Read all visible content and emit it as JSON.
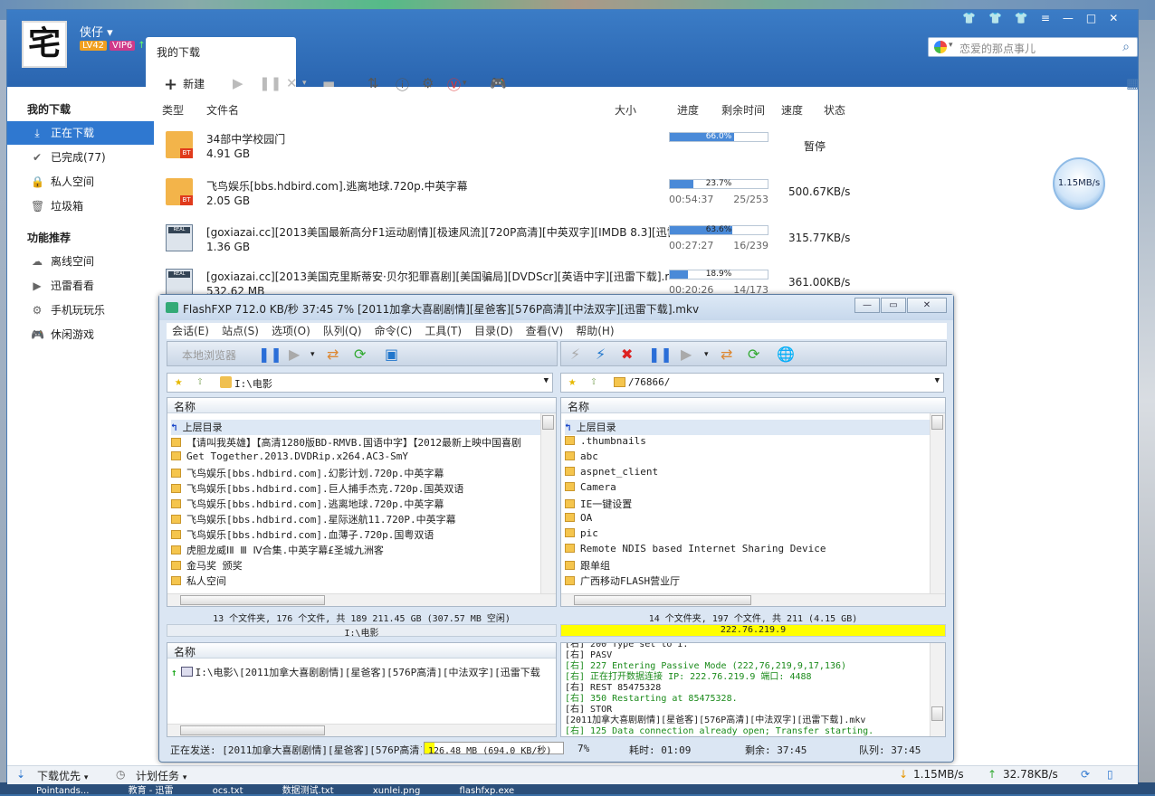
{
  "desktop": {
    "taskbar_items": [
      "Pointands...",
      "教育 - 迅雷",
      "ocs.txt",
      "数据测试.txt",
      "xunlei.png",
      "flashfxp.exe"
    ]
  },
  "xunlei": {
    "avatar_text": "宅",
    "username": "侠仔",
    "level": "LV42",
    "vip": "VIP6",
    "tab_title": "我的下载",
    "search_placeholder": "恋爱的那点事儿",
    "toolbar": {
      "new_label": "新建"
    },
    "sidebar": {
      "section1": "我的下载",
      "items1": [
        {
          "label": "正在下载",
          "icon": "download-icon"
        },
        {
          "label": "已完成(77)",
          "icon": "check-icon"
        },
        {
          "label": "私人空间",
          "icon": "lock-icon"
        },
        {
          "label": "垃圾箱",
          "icon": "trash-icon"
        }
      ],
      "section2": "功能推荐",
      "items2": [
        {
          "label": "离线空间",
          "icon": "cloud-icon"
        },
        {
          "label": "迅雷看看",
          "icon": "play-icon"
        },
        {
          "label": "手机玩玩乐",
          "icon": "gear-icon"
        },
        {
          "label": "休闲游戏",
          "icon": "gamepad-icon"
        }
      ]
    },
    "columns": {
      "type": "类型",
      "name": "文件名",
      "size": "大小",
      "progress": "进度",
      "remaining": "剩余时间",
      "speed": "速度",
      "status": "状态"
    },
    "rows": [
      {
        "name": "34部中学校园门",
        "size": "4.91 GB",
        "progress_label": "66.0%",
        "progress": 0.66,
        "eta": "",
        "blocks": "",
        "speed": "",
        "status": "暂停",
        "icon": "bt"
      },
      {
        "name": "飞鸟娱乐[bbs.hdbird.com].逃离地球.720p.中英字幕",
        "size": "2.05 GB",
        "progress_label": "23.7%",
        "progress": 0.237,
        "eta": "00:54:37",
        "blocks": "25/253",
        "speed": "500.67KB/s",
        "status": "",
        "icon": "bt"
      },
      {
        "name": "[goxiazai.cc][2013美国最新高分F1运动剧情][极速风流][720P高清][中英双字][IMDB 8.3][迅雷...",
        "size": "1.36 GB",
        "progress_label": "63.6%",
        "progress": 0.636,
        "eta": "00:27:27",
        "blocks": "16/239",
        "speed": "315.77KB/s",
        "status": "",
        "icon": "real"
      },
      {
        "name": "[goxiazai.cc][2013美国克里斯蒂安·贝尔犯罪喜剧][美国骗局][DVDScr][英语中字][迅雷下载].rmvb",
        "size": "532.62 MB",
        "progress_label": "18.9%",
        "progress": 0.189,
        "eta": "00:20:26",
        "blocks": "14/173",
        "speed": "361.00KB/s",
        "status": "",
        "icon": "real"
      }
    ],
    "speed_ball": "1.15MB/s",
    "status": {
      "priority": "下载优先",
      "schedule": "计划任务",
      "down": "1.15MB/s",
      "up": "32.78KB/s"
    }
  },
  "fxp": {
    "title": "FlashFXP 712.0 KB/秒 37:45 7% [2011加拿大喜剧剧情][星爸客][576P高清][中法双字][迅雷下载].mkv",
    "menu": [
      "会话(E)",
      "站点(S)",
      "选项(O)",
      "队列(Q)",
      "命令(C)",
      "工具(T)",
      "目录(D)",
      "查看(V)",
      "帮助(H)"
    ],
    "local_label": "本地浏览器",
    "local_path": "I:\\电影",
    "remote_path": "/76866/",
    "name_col": "名称",
    "local_files": [
      "上层目录",
      "【请叫我英雄】【高清1280版BD-RMVB.国语中字】【2012最新上映中国喜剧",
      "Get Together.2013.DVDRip.x264.AC3-SmY",
      "飞鸟娱乐[bbs.hdbird.com].幻影计划.720p.中英字幕",
      "飞鸟娱乐[bbs.hdbird.com].巨人捕手杰克.720p.国英双语",
      "飞鸟娱乐[bbs.hdbird.com].逃离地球.720p.中英字幕",
      "飞鸟娱乐[bbs.hdbird.com].星际迷航11.720P.中英字幕",
      "飞鸟娱乐[bbs.hdbird.com].血薄子.720p.国粤双语",
      "虎胆龙威ⅠⅡ Ⅲ Ⅳ合集.中英字幕£圣城九洲客",
      "金马奖 颁奖",
      "私人空间"
    ],
    "remote_files": [
      "上层目录",
      ".thumbnails",
      "abc",
      "aspnet_client",
      "Camera",
      "IE一键设置",
      "OA",
      "pic",
      "Remote NDIS based Internet Sharing Device",
      "跟单组",
      "广西移动FLASH营业厅"
    ],
    "local_summary": "13 个文件夹, 176 个文件, 共 189 211.45 GB (307.57 MB 空闲)",
    "local_path_footer": "I:\\电影",
    "remote_summary": "14 个文件夹, 197 个文件, 共 211 (4.15 GB)",
    "remote_host": "222.76.219.9",
    "queue_item": "I:\\电影\\[2011加拿大喜剧剧情][星爸客][576P高清][中法双字][迅雷下载",
    "log": [
      {
        "t": "[右] 200 Type set to I.",
        "g": false
      },
      {
        "t": "[右] PASV",
        "g": false
      },
      {
        "t": "[右] 227 Entering Passive Mode (222,76,219,9,17,136)",
        "g": true
      },
      {
        "t": "[右] 正在打开数据连接 IP: 222.76.219.9 端口: 4488",
        "g": true
      },
      {
        "t": "[右] REST 85475328",
        "g": false
      },
      {
        "t": "[右] 350 Restarting at 85475328.",
        "g": true
      },
      {
        "t": "[右] STOR",
        "g": false
      },
      {
        "t": "[2011加拿大喜剧剧情][星爸客][576P高清][中法双字][迅雷下载].mkv",
        "g": false
      },
      {
        "t": "[右] 125 Data connection already open; Transfer starting.",
        "g": true
      }
    ],
    "status": {
      "sending": "正在发送: [2011加拿大喜剧剧情][星爸客][576P高清][中法双字]",
      "bytes": "126.48 MB (694.0 KB/秒)",
      "pct": "7%",
      "elapsed": "耗时: 01:09",
      "remain": "剩余: 37:45",
      "queue": "队列: 37:45"
    }
  }
}
